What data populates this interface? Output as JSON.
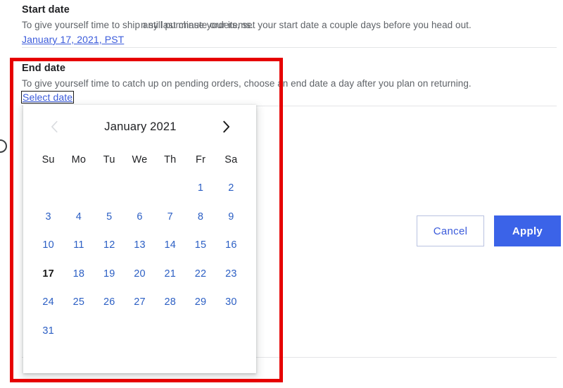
{
  "start_section": {
    "title": "Start date",
    "description": "To give yourself time to ship any last minute orders, set your start date a couple days before you head out.",
    "date_link": "January 17, 2021, PST"
  },
  "end_section": {
    "title": "End date",
    "description": "To give yourself time to catch up on pending orders, choose an end date a day after you plan on returning.",
    "date_link": "Select date"
  },
  "option_row": {
    "label": "n still purchase your items."
  },
  "actions": {
    "cancel_label": "Cancel",
    "apply_label": "Apply"
  },
  "calendar": {
    "month_label": "January 2021",
    "prev_icon": "chevron-left-icon",
    "next_icon": "chevron-right-icon",
    "weekdays": [
      "Su",
      "Mo",
      "Tu",
      "We",
      "Th",
      "Fr",
      "Sa"
    ],
    "leading_blanks": 5,
    "days": [
      1,
      2,
      3,
      4,
      5,
      6,
      7,
      8,
      9,
      10,
      11,
      12,
      13,
      14,
      15,
      16,
      17,
      18,
      19,
      20,
      21,
      22,
      23,
      24,
      25,
      26,
      27,
      28,
      29,
      30,
      31
    ],
    "today": 17
  },
  "colors": {
    "link_blue": "#3b5bdb",
    "day_blue": "#2c5fc4",
    "apply_blue": "#3b63e8",
    "annotation_red": "#e60000",
    "text_dark": "#202124",
    "text_muted": "#5f6368"
  }
}
